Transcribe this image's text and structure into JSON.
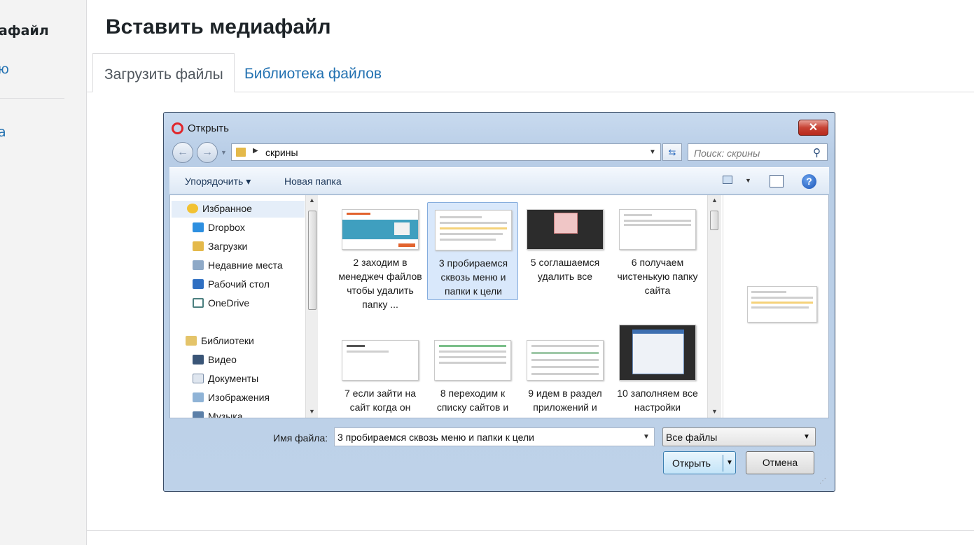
{
  "background_page": {
    "left_title": "афайл",
    "left_link1": "ю",
    "left_link2": "а",
    "modal_title": "Вставить медиафайл",
    "tabs": [
      {
        "label": "Загрузить файлы"
      },
      {
        "label": "Библиотека файлов"
      }
    ]
  },
  "dialog": {
    "title": "Открыть",
    "close_glyph": "✕",
    "back_glyph": "←",
    "forward_glyph": "→",
    "address_path": "скрины",
    "refresh_glyph": "⇆",
    "search_placeholder": "Поиск: скрины",
    "search_glyph": "⚲",
    "toolbar": {
      "organize": "Упорядочить ▾",
      "new_folder": "Новая папка",
      "help_glyph": "?"
    },
    "nav": [
      {
        "label": "Избранное",
        "icon": "star-icon"
      },
      {
        "label": "Dropbox",
        "icon": "dropbox-icon"
      },
      {
        "label": "Загрузки",
        "icon": "downloads-folder-icon"
      },
      {
        "label": "Недавние места",
        "icon": "recent-places-icon"
      },
      {
        "label": "Рабочий стол",
        "icon": "desktop-icon"
      },
      {
        "label": "OneDrive",
        "icon": "onedrive-icon"
      },
      {
        "label": "Библиотеки",
        "icon": "libraries-icon"
      },
      {
        "label": "Видео",
        "icon": "video-icon"
      },
      {
        "label": "Документы",
        "icon": "documents-icon"
      },
      {
        "label": "Изображения",
        "icon": "pictures-icon"
      },
      {
        "label": "Музыка",
        "icon": "music-icon"
      }
    ],
    "files": [
      {
        "label": "2 заходим в менеджеч файлов чтобы удалить папку ..."
      },
      {
        "label": "3 пробираемся сквозь меню и папки к цели"
      },
      {
        "label": "5 соглашаемся удалить все"
      },
      {
        "label": "6 получаем чистенькую папку сайта"
      },
      {
        "label": "7 если зайти на сайт когда он"
      },
      {
        "label": "8 переходим к списку сайтов и"
      },
      {
        "label": "9 идем в раздел приложений и"
      },
      {
        "label": "10 заполняем все настройки"
      }
    ],
    "filename_label": "Имя файла:",
    "filename_value": "3 пробираемся сквозь меню и папки к цели",
    "filetype_value": "Все файлы",
    "open_button": "Открыть",
    "cancel_button": "Отмена"
  },
  "colors": {
    "link": "#2271b1",
    "selection": "#d9e8fb",
    "close_red": "#c74234"
  }
}
